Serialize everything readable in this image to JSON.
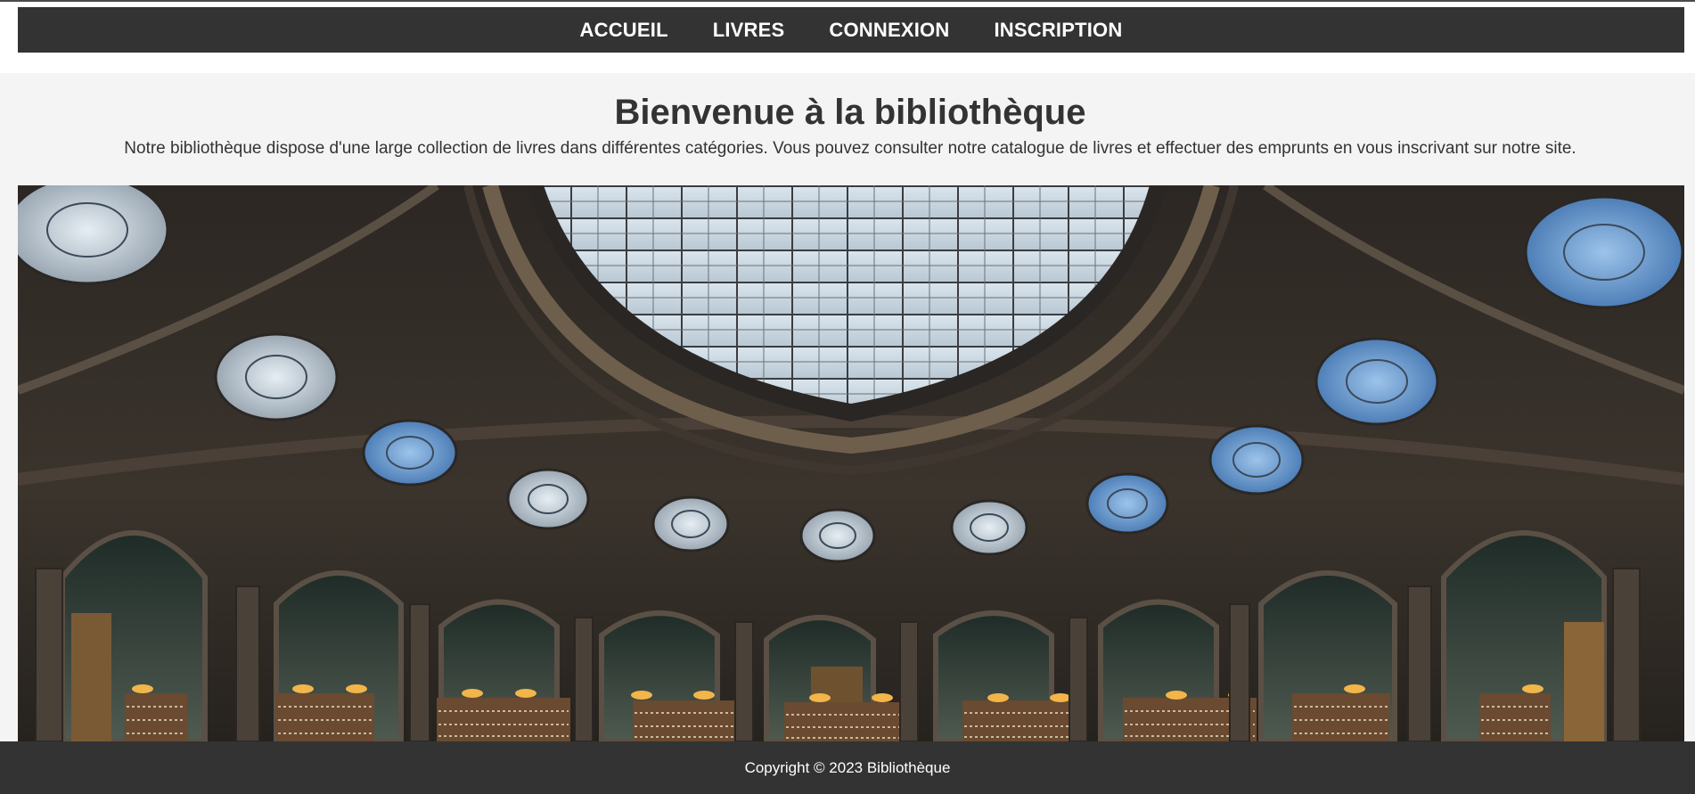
{
  "nav": {
    "items": [
      {
        "label": "ACCUEIL"
      },
      {
        "label": "LIVRES"
      },
      {
        "label": "CONNEXION"
      },
      {
        "label": "INSCRIPTION"
      }
    ]
  },
  "hero": {
    "title": "Bienvenue à la bibliothèque",
    "text": "Notre bibliothèque dispose d'une large collection de livres dans différentes catégories. Vous pouvez consulter notre catalogue de livres et effectuer des emprunts en vous inscrivant sur notre site."
  },
  "footer": {
    "text": "Copyright © 2023 Bibliothèque"
  },
  "colors": {
    "nav_background": "#333333",
    "page_background": "#f4f4f4",
    "footer_background": "#333333",
    "text": "#333333"
  }
}
